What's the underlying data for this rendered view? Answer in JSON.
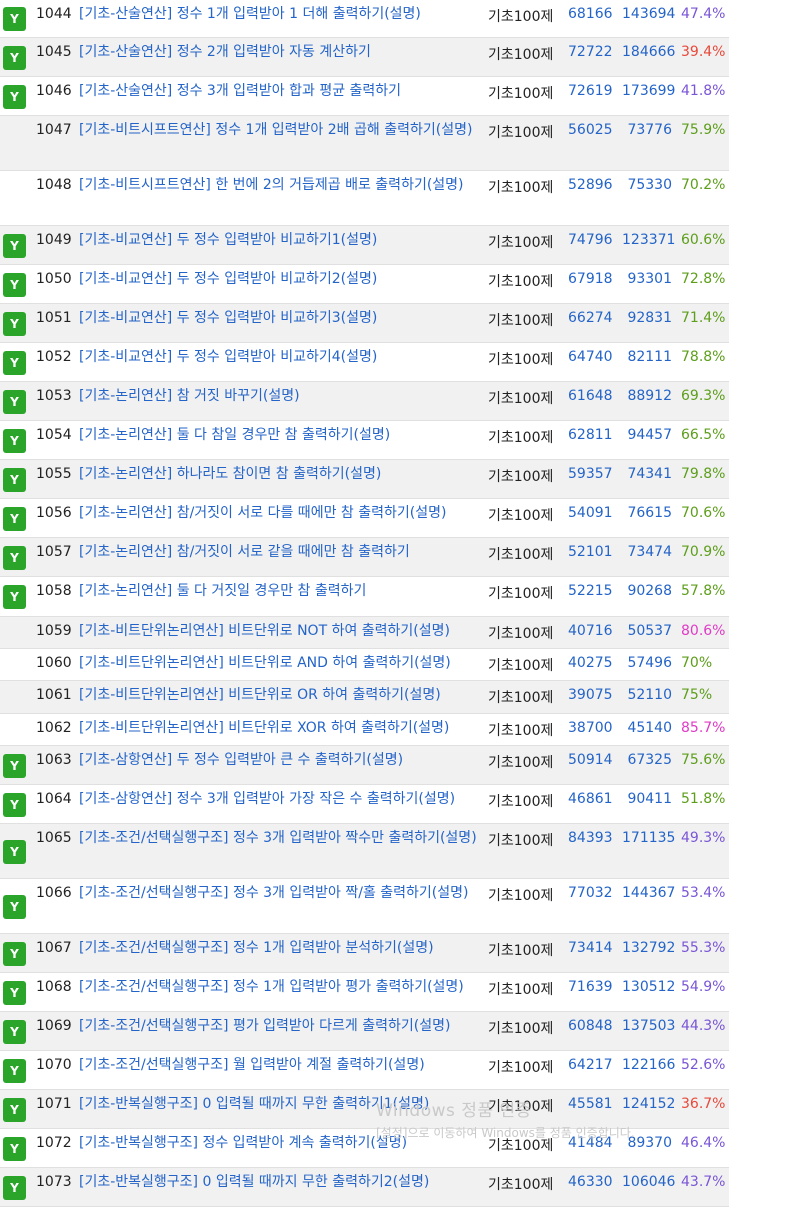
{
  "badge_label": "Y",
  "colors": {
    "green": "#5d9e1b",
    "red": "#e8493a",
    "purple": "#7a56d6",
    "magenta": "#e03bc6",
    "link": "#2464c8"
  },
  "problems": [
    {
      "id": "1044",
      "title": "[기초-산술연산] 정수 1개 입력받아 1 더해 출력하기(설명)",
      "category": "기초100제",
      "solved": "68166",
      "submissions": "143694",
      "rate": "47.4%",
      "rate_color": "purple",
      "badge": true
    },
    {
      "id": "1045",
      "title": "[기초-산술연산] 정수 2개 입력받아 자동 계산하기",
      "category": "기초100제",
      "solved": "72722",
      "submissions": "184666",
      "rate": "39.4%",
      "rate_color": "red",
      "badge": true
    },
    {
      "id": "1046",
      "title": "[기초-산술연산] 정수 3개 입력받아 합과 평균 출력하기",
      "category": "기초100제",
      "solved": "72619",
      "submissions": "173699",
      "rate": "41.8%",
      "rate_color": "purple",
      "badge": true
    },
    {
      "id": "1047",
      "title": "[기초-비트시프트연산] 정수 1개 입력받아 2배 곱해 출력하기(설명)",
      "category": "기초100제",
      "solved": "56025",
      "submissions": "73776",
      "rate": "75.9%",
      "rate_color": "green",
      "badge": false
    },
    {
      "id": "1048",
      "title": "[기초-비트시프트연산] 한 번에 2의 거듭제곱 배로 출력하기(설명)",
      "category": "기초100제",
      "solved": "52896",
      "submissions": "75330",
      "rate": "70.2%",
      "rate_color": "green",
      "badge": false
    },
    {
      "id": "1049",
      "title": "[기초-비교연산] 두 정수 입력받아 비교하기1(설명)",
      "category": "기초100제",
      "solved": "74796",
      "submissions": "123371",
      "rate": "60.6%",
      "rate_color": "green",
      "badge": true
    },
    {
      "id": "1050",
      "title": "[기초-비교연산] 두 정수 입력받아 비교하기2(설명)",
      "category": "기초100제",
      "solved": "67918",
      "submissions": "93301",
      "rate": "72.8%",
      "rate_color": "green",
      "badge": true
    },
    {
      "id": "1051",
      "title": "[기초-비교연산] 두 정수 입력받아 비교하기3(설명)",
      "category": "기초100제",
      "solved": "66274",
      "submissions": "92831",
      "rate": "71.4%",
      "rate_color": "green",
      "badge": true
    },
    {
      "id": "1052",
      "title": "[기초-비교연산] 두 정수 입력받아 비교하기4(설명)",
      "category": "기초100제",
      "solved": "64740",
      "submissions": "82111",
      "rate": "78.8%",
      "rate_color": "green",
      "badge": true
    },
    {
      "id": "1053",
      "title": "[기초-논리연산] 참 거짓 바꾸기(설명)",
      "category": "기초100제",
      "solved": "61648",
      "submissions": "88912",
      "rate": "69.3%",
      "rate_color": "green",
      "badge": true
    },
    {
      "id": "1054",
      "title": "[기초-논리연산] 둘 다 참일 경우만 참 출력하기(설명)",
      "category": "기초100제",
      "solved": "62811",
      "submissions": "94457",
      "rate": "66.5%",
      "rate_color": "green",
      "badge": true
    },
    {
      "id": "1055",
      "title": "[기초-논리연산] 하나라도 참이면 참 출력하기(설명)",
      "category": "기초100제",
      "solved": "59357",
      "submissions": "74341",
      "rate": "79.8%",
      "rate_color": "green",
      "badge": true
    },
    {
      "id": "1056",
      "title": "[기초-논리연산] 참/거짓이 서로 다를 때에만 참 출력하기(설명)",
      "category": "기초100제",
      "solved": "54091",
      "submissions": "76615",
      "rate": "70.6%",
      "rate_color": "green",
      "badge": true
    },
    {
      "id": "1057",
      "title": "[기초-논리연산] 참/거짓이 서로 같을 때에만 참 출력하기",
      "category": "기초100제",
      "solved": "52101",
      "submissions": "73474",
      "rate": "70.9%",
      "rate_color": "green",
      "badge": true
    },
    {
      "id": "1058",
      "title": "[기초-논리연산] 둘 다 거짓일 경우만 참 출력하기",
      "category": "기초100제",
      "solved": "52215",
      "submissions": "90268",
      "rate": "57.8%",
      "rate_color": "green",
      "badge": true
    },
    {
      "id": "1059",
      "title": "[기초-비트단위논리연산] 비트단위로 NOT 하여 출력하기(설명)",
      "category": "기초100제",
      "solved": "40716",
      "submissions": "50537",
      "rate": "80.6%",
      "rate_color": "magenta",
      "badge": false
    },
    {
      "id": "1060",
      "title": "[기초-비트단위논리연산] 비트단위로 AND 하여 출력하기(설명)",
      "category": "기초100제",
      "solved": "40275",
      "submissions": "57496",
      "rate": "70%",
      "rate_color": "green",
      "badge": false
    },
    {
      "id": "1061",
      "title": "[기초-비트단위논리연산] 비트단위로 OR 하여 출력하기(설명)",
      "category": "기초100제",
      "solved": "39075",
      "submissions": "52110",
      "rate": "75%",
      "rate_color": "green",
      "badge": false
    },
    {
      "id": "1062",
      "title": "[기초-비트단위논리연산] 비트단위로 XOR 하여 출력하기(설명)",
      "category": "기초100제",
      "solved": "38700",
      "submissions": "45140",
      "rate": "85.7%",
      "rate_color": "magenta",
      "badge": false
    },
    {
      "id": "1063",
      "title": "[기초-삼항연산] 두 정수 입력받아 큰 수 출력하기(설명)",
      "category": "기초100제",
      "solved": "50914",
      "submissions": "67325",
      "rate": "75.6%",
      "rate_color": "green",
      "badge": true
    },
    {
      "id": "1064",
      "title": "[기초-삼항연산] 정수 3개 입력받아 가장 작은 수 출력하기(설명)",
      "category": "기초100제",
      "solved": "46861",
      "submissions": "90411",
      "rate": "51.8%",
      "rate_color": "green",
      "badge": true
    },
    {
      "id": "1065",
      "title": "[기초-조건/선택실행구조] 정수 3개 입력받아 짝수만 출력하기(설명)",
      "category": "기초100제",
      "solved": "84393",
      "submissions": "171135",
      "rate": "49.3%",
      "rate_color": "purple",
      "badge": true
    },
    {
      "id": "1066",
      "title": "[기초-조건/선택실행구조] 정수 3개 입력받아 짝/홀 출력하기(설명)",
      "category": "기초100제",
      "solved": "77032",
      "submissions": "144367",
      "rate": "53.4%",
      "rate_color": "purple",
      "badge": true
    },
    {
      "id": "1067",
      "title": "[기초-조건/선택실행구조] 정수 1개 입력받아 분석하기(설명)",
      "category": "기초100제",
      "solved": "73414",
      "submissions": "132792",
      "rate": "55.3%",
      "rate_color": "purple",
      "badge": true
    },
    {
      "id": "1068",
      "title": "[기초-조건/선택실행구조] 정수 1개 입력받아 평가 출력하기(설명)",
      "category": "기초100제",
      "solved": "71639",
      "submissions": "130512",
      "rate": "54.9%",
      "rate_color": "purple",
      "badge": true
    },
    {
      "id": "1069",
      "title": "[기초-조건/선택실행구조] 평가 입력받아 다르게 출력하기(설명)",
      "category": "기초100제",
      "solved": "60848",
      "submissions": "137503",
      "rate": "44.3%",
      "rate_color": "purple",
      "badge": true
    },
    {
      "id": "1070",
      "title": "[기초-조건/선택실행구조] 월 입력받아 계절 출력하기(설명)",
      "category": "기초100제",
      "solved": "64217",
      "submissions": "122166",
      "rate": "52.6%",
      "rate_color": "purple",
      "badge": true
    },
    {
      "id": "1071",
      "title": "[기초-반복실행구조] 0 입력될 때까지 무한 출력하기1(설명)",
      "category": "기초100제",
      "solved": "45581",
      "submissions": "124152",
      "rate": "36.7%",
      "rate_color": "red",
      "badge": true
    },
    {
      "id": "1072",
      "title": "[기초-반복실행구조] 정수 입력받아 계속 출력하기(설명)",
      "category": "기초100제",
      "solved": "41484",
      "submissions": "89370",
      "rate": "46.4%",
      "rate_color": "purple",
      "badge": true
    },
    {
      "id": "1073",
      "title": "[기초-반복실행구조] 0 입력될 때까지 무한 출력하기2(설명)",
      "category": "기초100제",
      "solved": "46330",
      "submissions": "106046",
      "rate": "43.7%",
      "rate_color": "purple",
      "badge": true
    }
  ],
  "watermark": {
    "line1": "Windows 정품 인증",
    "line2": "[설정]으로 이동하여 Windows를 정품 인증합니다."
  }
}
